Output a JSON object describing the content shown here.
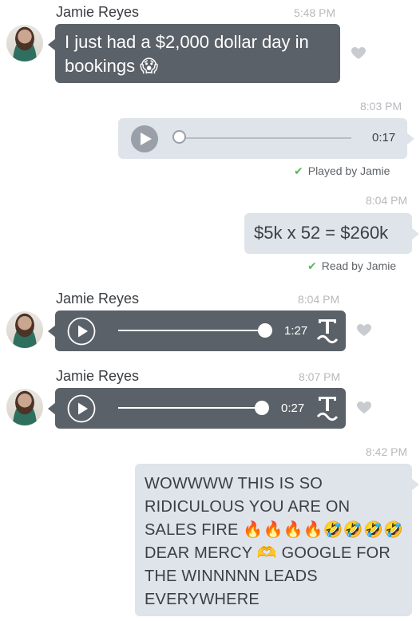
{
  "messages": [
    {
      "sender": "Jamie Reyes",
      "time": "5:48 PM",
      "text": "I just had a $2,000 dollar day in bookings 😱"
    },
    {
      "time": "8:03 PM",
      "duration": "0:17",
      "receipt": "Played by Jamie"
    },
    {
      "time": "8:04 PM",
      "text": "$5k x 52 = $260k",
      "receipt": "Read by Jamie"
    },
    {
      "sender": "Jamie Reyes",
      "time": "8:04 PM",
      "duration": "1:27"
    },
    {
      "sender": "Jamie Reyes",
      "time": "8:07 PM",
      "duration": "0:27"
    },
    {
      "time": "8:42 PM",
      "text": "WOWWWW THIS IS SO RIDICULOUS YOU ARE ON SALES FIRE 🔥🔥🔥🔥🤣🤣🤣🤣 DEAR MERCY 🫶 GOOGLE FOR THE WINNNNN LEADS EVERYWHERE"
    }
  ],
  "icons": {
    "play": "play-icon",
    "transcribe": "transcribe-icon",
    "like": "heart-icon",
    "receipt": "check-icon"
  },
  "colors": {
    "incoming_bubble": "#5b6168",
    "outgoing_bubble": "#dfe4ea",
    "receipt_check": "#5cb85c",
    "timestamp": "#b6b9bd"
  }
}
